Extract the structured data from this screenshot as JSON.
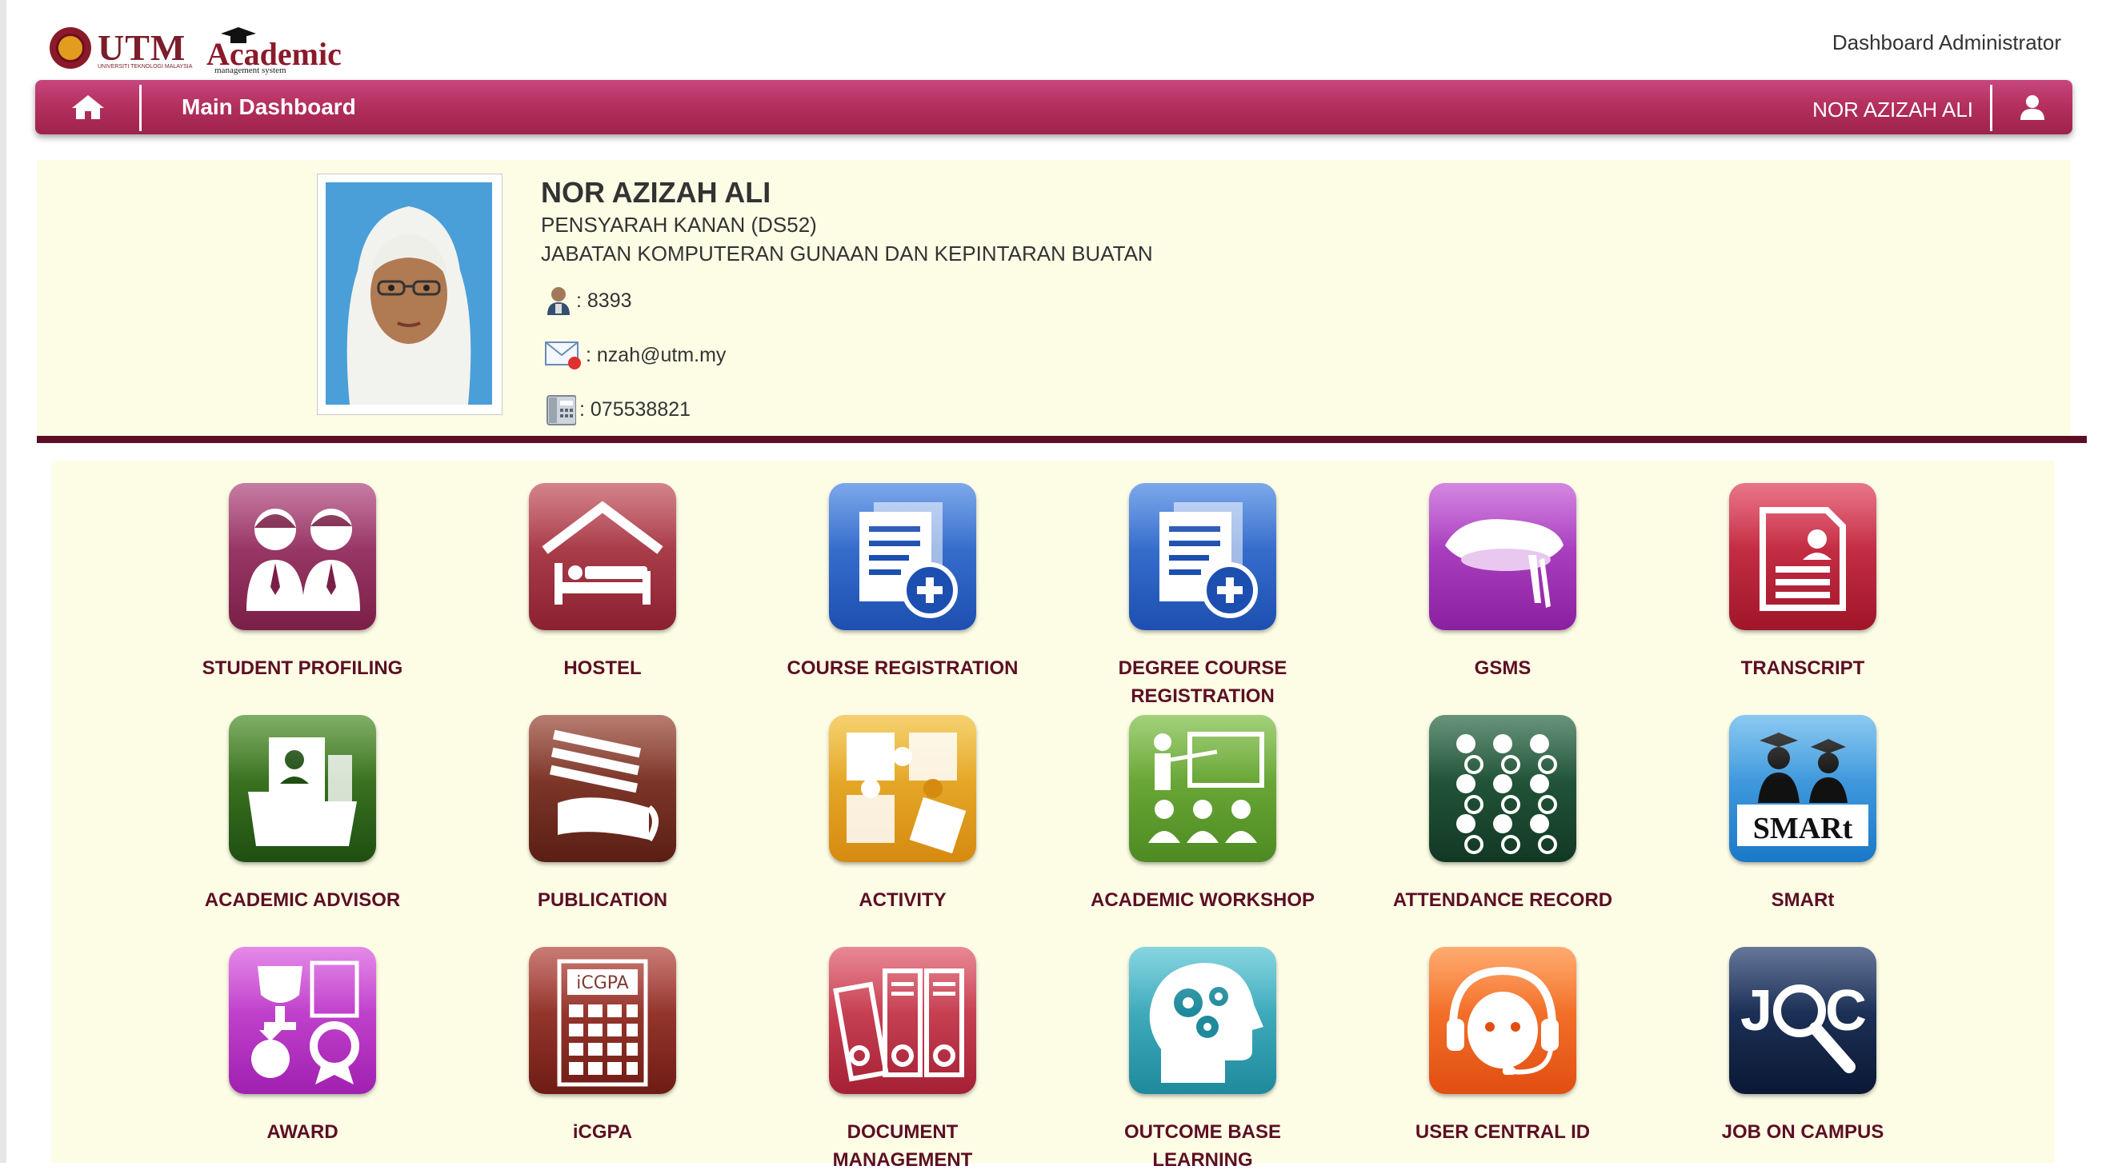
{
  "header": {
    "utm_logo_text": "UTM",
    "utm_logo_subtext": "UNIVERSITI TEKNOLOGI MALAYSIA",
    "academic_logo_text": "Academic",
    "academic_logo_subtext": "management system",
    "role_label": "Dashboard Administrator"
  },
  "navbar": {
    "title": "Main Dashboard",
    "user_name": "NOR AZIZAH ALI"
  },
  "profile": {
    "name": "NOR AZIZAH ALI",
    "position": "PENSYARAH KANAN (DS52)",
    "department": "JABATAN KOMPUTERAN GUNAAN DAN KEPINTARAN BUATAN",
    "staff_id": ": 8393",
    "email": ": nzah@utm.my",
    "phone": ": 075538821"
  },
  "apps": [
    {
      "label": "STUDENT PROFILING",
      "icon": "students-icon",
      "color": "#8e2a5a"
    },
    {
      "label": "HOSTEL",
      "icon": "hostel-bed-icon",
      "color": "#a3324a"
    },
    {
      "label": "COURSE REGISTRATION",
      "icon": "document-add-icon",
      "color": "#2a64c8"
    },
    {
      "label": "DEGREE COURSE REGISTRATION",
      "icon": "document-add-icon",
      "color": "#2a64c8"
    },
    {
      "label": "GSMS",
      "icon": "graduation-hat-icon",
      "color": "#a02ab8"
    },
    {
      "label": "TRANSCRIPT",
      "icon": "transcript-icon",
      "color": "#c2213d"
    },
    {
      "label": "ACADEMIC ADVISOR",
      "icon": "advisor-folder-icon",
      "color": "#2f6d1c"
    },
    {
      "label": "PUBLICATION",
      "icon": "publication-books-icon",
      "color": "#6e2b1f"
    },
    {
      "label": "ACTIVITY",
      "icon": "puzzle-icon",
      "color": "#e2a21e"
    },
    {
      "label": "ACADEMIC WORKSHOP",
      "icon": "workshop-presenter-icon",
      "color": "#6aa733"
    },
    {
      "label": "ATTENDANCE RECORD",
      "icon": "attendance-icon",
      "color": "#1e4d33"
    },
    {
      "label": "SMARt",
      "icon": "smart-graduates-icon",
      "color": "#2b8ed8"
    },
    {
      "label": "AWARD",
      "icon": "award-trophy-icon",
      "color": "#c236c9"
    },
    {
      "label": "iCGPA",
      "icon": "calculator-icon",
      "color": "#8a2a24"
    },
    {
      "label": "DOCUMENT MANAGEMENT",
      "icon": "binders-icon",
      "color": "#c23a4e"
    },
    {
      "label": "OUTCOME BASE LEARNING",
      "icon": "head-gears-icon",
      "color": "#2ea2b4"
    },
    {
      "label": "USER CENTRAL ID",
      "icon": "support-headset-icon",
      "color": "#f06524"
    },
    {
      "label": "JOB ON CAMPUS",
      "icon": "job-search-icon",
      "color": "#12244a"
    }
  ]
}
